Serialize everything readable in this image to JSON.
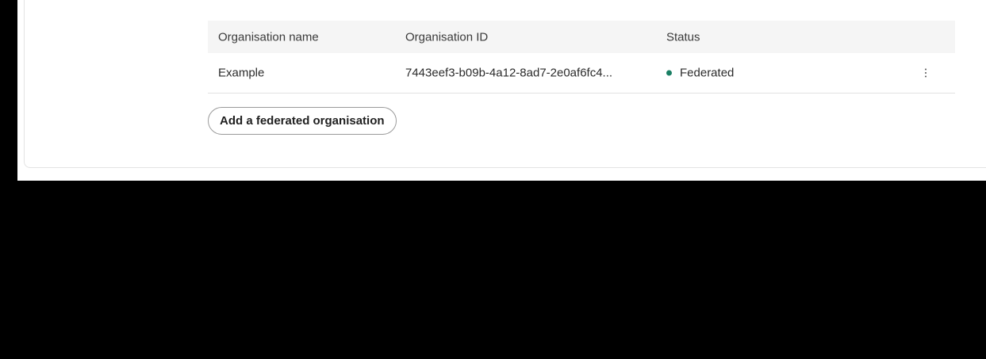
{
  "table": {
    "columns": [
      "Organisation name",
      "Organisation ID",
      "Status"
    ],
    "rows": [
      {
        "name": "Example",
        "id": "7443eef3-b09b-4a12-8ad7-2e0af6fc4...",
        "status": "Federated"
      }
    ]
  },
  "actions": {
    "add_label": "Add a federated organisation"
  },
  "colors": {
    "status_federated": "#1a7f64",
    "header_bg": "#f5f5f5",
    "backdrop": "#000000"
  },
  "icons": {
    "row_menu": "more-vertical-icon",
    "status": "status-dot-icon"
  }
}
